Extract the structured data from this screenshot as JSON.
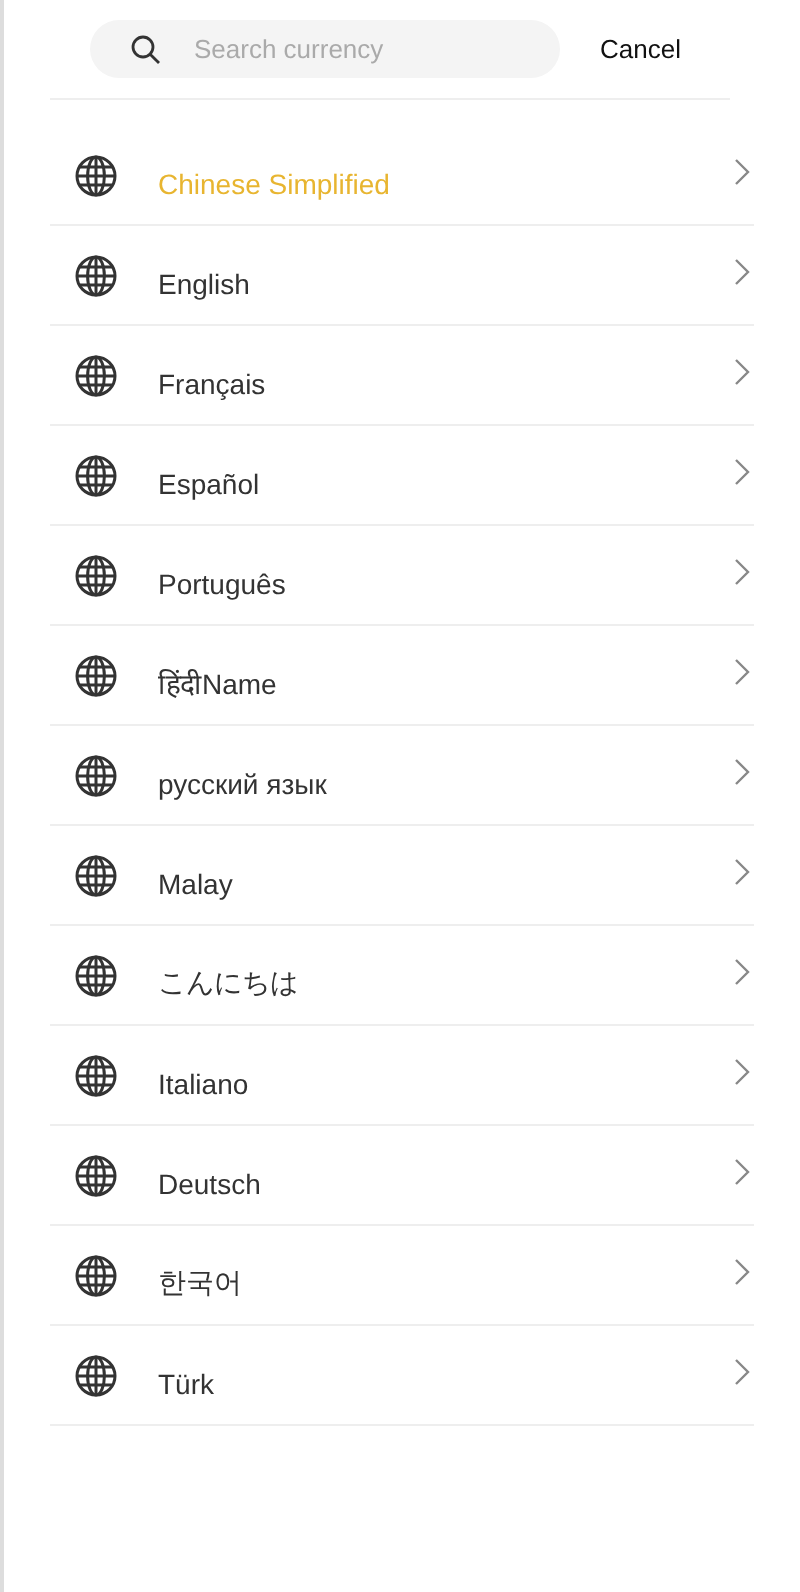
{
  "search": {
    "placeholder": "Search currency",
    "cancel": "Cancel"
  },
  "languages": [
    {
      "label": "Chinese Simplified",
      "selected": true
    },
    {
      "label": "English",
      "selected": false
    },
    {
      "label": "Français",
      "selected": false
    },
    {
      "label": "Español",
      "selected": false
    },
    {
      "label": "Português",
      "selected": false
    },
    {
      "label": "हिंदीName",
      "selected": false
    },
    {
      "label": "русский язык",
      "selected": false
    },
    {
      "label": "Malay",
      "selected": false
    },
    {
      "label": "こんにちは",
      "selected": false
    },
    {
      "label": "Italiano",
      "selected": false
    },
    {
      "label": "Deutsch",
      "selected": false
    },
    {
      "label": "한국어",
      "selected": false
    },
    {
      "label": "Türk",
      "selected": false
    }
  ]
}
